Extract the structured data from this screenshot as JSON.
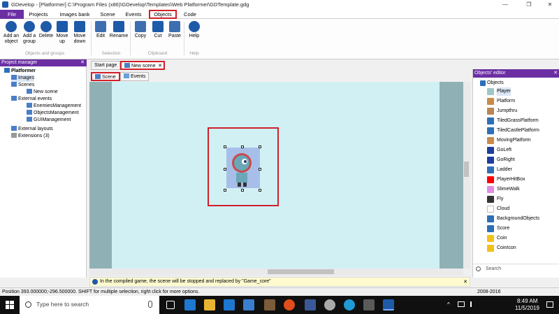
{
  "window": {
    "title": "GDevelop - [Platformer] C:\\Program Files (x86)\\GDevelop\\Templates\\Web Platformer\\GDTemplate.gdg",
    "minimize": "—",
    "maximize": "❐",
    "close": "✕"
  },
  "ribbon_tabs": [
    "File",
    "Projects",
    "Images bank",
    "Scene",
    "Events",
    "Objects",
    "Code"
  ],
  "ribbon": {
    "buttons": [
      {
        "label": "Add an object",
        "icon": "add-object-icon"
      },
      {
        "label": "Add a group",
        "icon": "add-group-icon"
      },
      {
        "label": "Delete",
        "icon": "delete-icon"
      },
      {
        "label": "Move up",
        "icon": "move-up-icon"
      },
      {
        "label": "Move down",
        "icon": "move-down-icon"
      },
      {
        "label": "Edit",
        "icon": "edit-icon"
      },
      {
        "label": "Rename",
        "icon": "rename-icon"
      },
      {
        "label": "Copy",
        "icon": "copy-icon"
      },
      {
        "label": "Cut",
        "icon": "cut-icon"
      },
      {
        "label": "Paste",
        "icon": "paste-icon"
      },
      {
        "label": "Help",
        "icon": "help-icon"
      }
    ],
    "groups": [
      "Objects and groups",
      "Selection",
      "Clipboard",
      "Help"
    ]
  },
  "project_manager": {
    "title": "Project manager",
    "close": "✕",
    "tree": [
      {
        "label": "Platformer",
        "level": 0,
        "bold": true
      },
      {
        "label": "Images",
        "level": 1
      },
      {
        "label": "Scenes",
        "level": 1
      },
      {
        "label": "New scene",
        "level": 2
      },
      {
        "label": "External events",
        "level": 1
      },
      {
        "label": "EnemiesManagement",
        "level": 2
      },
      {
        "label": "ObjectsManagement",
        "level": 2
      },
      {
        "label": "GUIManagement",
        "level": 2
      },
      {
        "label": "External layouts",
        "level": 1
      },
      {
        "label": "Extensions (3)",
        "level": 1
      }
    ]
  },
  "doc_tabs": [
    "Start page",
    "New scene"
  ],
  "doc_tab_close": "✕",
  "sub_tabs": [
    "Scene",
    "Events"
  ],
  "info_bar": "In the compiled game, the scene will be stopped and replaced by \"Game_core\"",
  "info_close": "✕",
  "objects_editor": {
    "title": "Objects' editor",
    "close": "✕",
    "root": "Objects",
    "items": [
      {
        "label": "Player",
        "color": "#9fc7c7",
        "selected": true
      },
      {
        "label": "Platform",
        "color": "#c98b4a"
      },
      {
        "label": "Jumpthru",
        "color": "#b98656"
      },
      {
        "label": "TiledGrassPlatform",
        "color": "#2f6fb8"
      },
      {
        "label": "TiledCastlePlatform",
        "color": "#2f6fb8"
      },
      {
        "label": "MovingPlatform",
        "color": "#c98b4a"
      },
      {
        "label": "GoLeft",
        "color": "#1d3f9a"
      },
      {
        "label": "GoRight",
        "color": "#1d3f9a"
      },
      {
        "label": "Ladder",
        "color": "#2f6fb8"
      },
      {
        "label": "PlayerHitBox",
        "color": "#ff0000"
      },
      {
        "label": "SlimeWalk",
        "color": "#e18be6"
      },
      {
        "label": "Fly",
        "color": "#333333"
      },
      {
        "label": "Cloud",
        "color": "#ffffff"
      },
      {
        "label": "BackgroundObjects",
        "color": "#2f6fb8"
      },
      {
        "label": "Score",
        "color": "#2f6fb8"
      },
      {
        "label": "Coin",
        "color": "#f2c21a"
      },
      {
        "label": "CoinIcon",
        "color": "#f2c21a"
      }
    ],
    "search_placeholder": "Search"
  },
  "status": {
    "left": "Position 393.000000;-296.500000. SHIFT for multiple selection, right click for more options.",
    "right": "2008-2016"
  },
  "taskbar": {
    "search_placeholder": "Type here to search",
    "time": "8:49 AM",
    "date": "11/5/2019"
  },
  "colors": {
    "accent": "#6b2fa3",
    "highlight": "#d0202a",
    "scene_bg": "#d1f0f4",
    "scene_border": "#8fb1b5"
  }
}
